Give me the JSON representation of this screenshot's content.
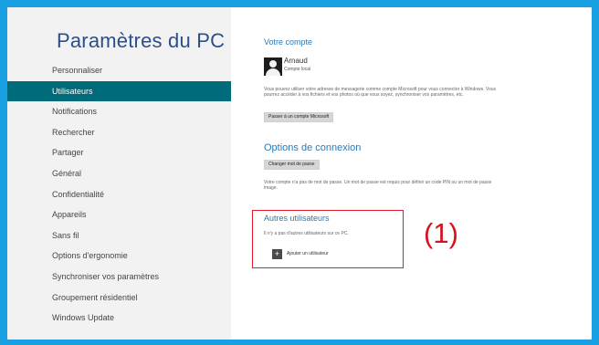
{
  "sidebar": {
    "title": "Paramètres du PC",
    "items": [
      {
        "label": "Personnaliser"
      },
      {
        "label": "Utilisateurs"
      },
      {
        "label": "Notifications"
      },
      {
        "label": "Rechercher"
      },
      {
        "label": "Partager"
      },
      {
        "label": "Général"
      },
      {
        "label": "Confidentialité"
      },
      {
        "label": "Appareils"
      },
      {
        "label": "Sans fil"
      },
      {
        "label": "Options d'ergonomie"
      },
      {
        "label": "Synchroniser vos paramètres"
      },
      {
        "label": "Groupement résidentiel"
      },
      {
        "label": "Windows Update"
      }
    ],
    "selected": "Utilisateurs"
  },
  "main": {
    "account": {
      "title": "Votre compte",
      "user_name": "Arnaud",
      "user_type": "Compte local",
      "description": "Vous pouvez utiliser votre adresse de messagerie comme compte Microsoft pour vous connecter à Windows. Vous pourrez accéder à vos fichiers et vos photos où que vous soyez, synchroniser vos paramètres, etc.",
      "switch_button": "Passer à un compte Microsoft"
    },
    "signin": {
      "title": "Options de connexion",
      "change_password_button": "Changer mot de passe",
      "description": "Votre compte n'a pas de mot de passe. Un mot de passe est requis pour définir un code PIN ou un mot de passe image."
    },
    "other_users": {
      "title": "Autres utilisateurs",
      "description": "Il n'y a pas d'autres utilisateurs sur ce PC.",
      "add_label": "Ajouter un utilisateur",
      "add_icon_glyph": "+"
    }
  },
  "annotation": {
    "label": "(1)",
    "color": "#d7111e"
  },
  "colors": {
    "frame_border": "#19a0e2",
    "selected_item_bg": "#006b7a",
    "accent_text": "#2b79b6"
  }
}
